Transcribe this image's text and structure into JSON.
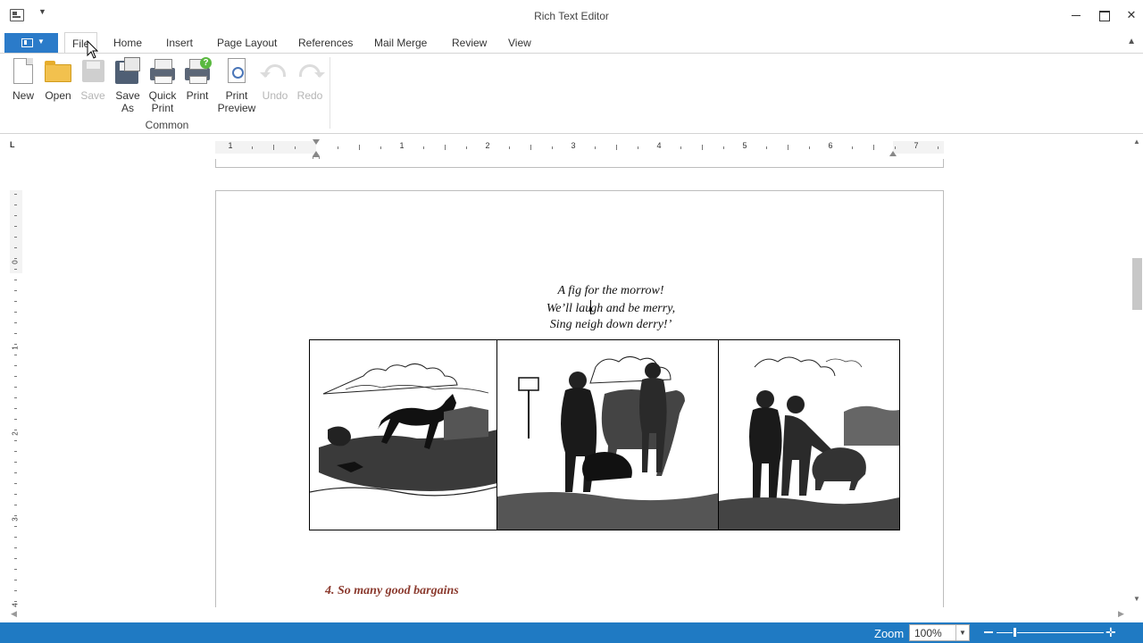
{
  "window": {
    "title": "Rich Text Editor"
  },
  "tabs": [
    {
      "label": "File",
      "active": true
    },
    {
      "label": "Home"
    },
    {
      "label": "Insert"
    },
    {
      "label": "Page Layout"
    },
    {
      "label": "References"
    },
    {
      "label": "Mail Merge"
    },
    {
      "label": "Review"
    },
    {
      "label": "View"
    }
  ],
  "ribbon": {
    "group_label": "Common",
    "buttons": [
      {
        "label_lines": [
          "New"
        ],
        "icon": "new-document-icon",
        "enabled": true
      },
      {
        "label_lines": [
          "Open"
        ],
        "icon": "folder-icon",
        "enabled": true
      },
      {
        "label_lines": [
          "Save"
        ],
        "icon": "floppy-disk-icon",
        "enabled": false
      },
      {
        "label_lines": [
          "Save",
          "As"
        ],
        "icon": "save-as-icon",
        "enabled": true
      },
      {
        "label_lines": [
          "Quick",
          "Print"
        ],
        "icon": "printer-icon",
        "enabled": true
      },
      {
        "label_lines": [
          "Print"
        ],
        "icon": "printer-help-icon",
        "enabled": true
      },
      {
        "label_lines": [
          "Print",
          "Preview"
        ],
        "icon": "print-preview-icon",
        "enabled": true
      },
      {
        "label_lines": [
          "Undo"
        ],
        "icon": "undo-icon",
        "enabled": false
      },
      {
        "label_lines": [
          "Redo"
        ],
        "icon": "redo-icon",
        "enabled": false
      }
    ]
  },
  "ruler": {
    "corner_glyph": "L",
    "h_numbers": [
      "1",
      "1",
      "2",
      "3",
      "4",
      "5",
      "6",
      "7"
    ],
    "v_numbers": [
      "0",
      "1",
      "2",
      "3",
      "4"
    ]
  },
  "document": {
    "poem_lines": [
      "A fig for the morrow!",
      "We’ll lau",
      "gh and be merry,",
      "Sing neigh down derry!’"
    ],
    "images": [
      {
        "name": "woodcut-horse-rider-fall",
        "desc_icon": "image-icon"
      },
      {
        "name": "woodcut-peasants-with-cow",
        "desc_icon": "image-icon"
      },
      {
        "name": "woodcut-men-with-pig",
        "desc_icon": "image-icon"
      }
    ],
    "heading": "4. So many good bargains"
  },
  "status": {
    "zoom_label": "Zoom",
    "zoom_value": "100%",
    "zoom_level_fraction": 0.17
  },
  "colors": {
    "accent": "#2b7bc9",
    "statusbar": "#1f7ac3",
    "heading": "#8b3a2e"
  }
}
